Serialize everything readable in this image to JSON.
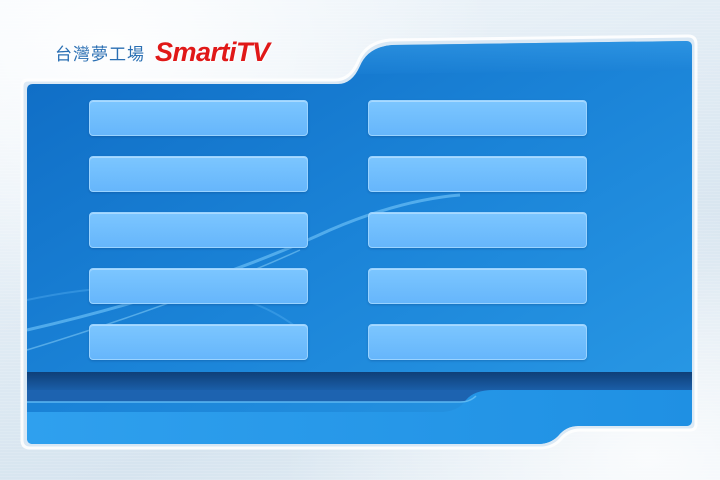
{
  "brand": {
    "name_cn": "台灣夢工場",
    "logo_text": "SmartiTV",
    "logo_color": "#e01818",
    "name_color": "#2a6fb3"
  },
  "menu": {
    "left": [
      {
        "label": ""
      },
      {
        "label": ""
      },
      {
        "label": ""
      },
      {
        "label": ""
      },
      {
        "label": ""
      }
    ],
    "right": [
      {
        "label": ""
      },
      {
        "label": ""
      },
      {
        "label": ""
      },
      {
        "label": ""
      },
      {
        "label": ""
      }
    ]
  },
  "colors": {
    "panel_blue": "#1a7fd4",
    "button_blue": "#66b6fb",
    "band_dark": "#134a86"
  }
}
